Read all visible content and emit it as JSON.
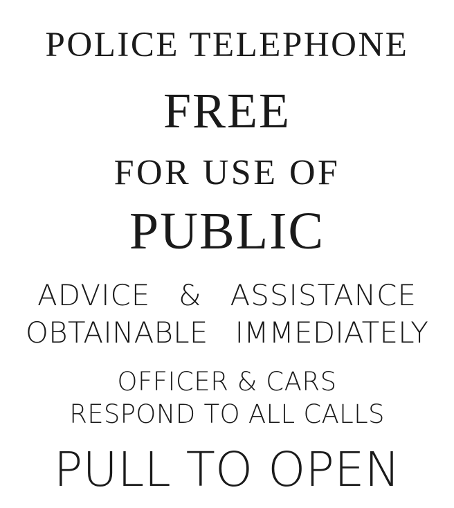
{
  "sign": {
    "line1": "POLICE TELEPHONE",
    "line2": "FREE",
    "line3": "FOR USE OF",
    "line4": "PUBLIC",
    "line5": "ADVICE  &  ASSISTANCE",
    "line6": "OBTAINABLE  IMMEDIATELY",
    "line7": "OFFICER & CARS",
    "line8": "RESPOND TO ALL CALLS",
    "line9": "PULL TO OPEN"
  },
  "colors": {
    "background": "#ffffff",
    "text": "#1a1a1a"
  }
}
